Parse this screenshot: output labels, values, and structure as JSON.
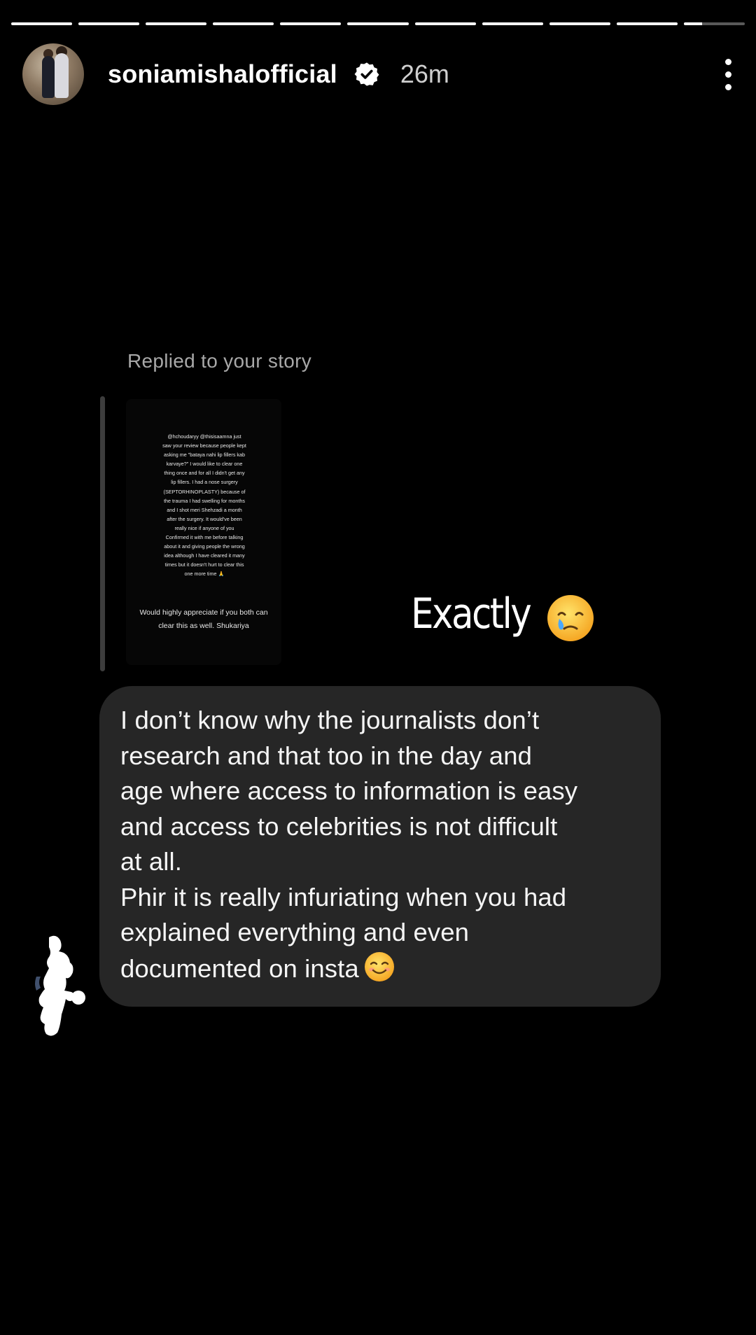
{
  "story": {
    "segments_total": 11,
    "current_segment_progress": 0.3
  },
  "header": {
    "username": "soniamishalofficial",
    "time": "26m",
    "verified_icon": "verified-badge-icon",
    "more_icon": "more-vertical-icon"
  },
  "reply": {
    "label": "Replied to your story",
    "story_text": "@hchoudaryy @thisisaamna just saw your review because people kept asking me \"bataya nahi lip fillers kab karvaye?\" I would like to clear one thing once and for all I didn't get any lip fillers. I had a nose surgery (SEPTORHINOPLASTY) because of the trauma I had swelling for months and I shot meri Shehzadi a month after the surgery. It would've been really nice if anyone of you Confirmed it with me before talking about it and giving people the wrong idea although I have cleared it many times but it doesn't hurt to clear this one more time 🙏",
    "story_text_2": "Would highly appreciate if you both can clear this as well. Shukariya",
    "overlay_text": "Exactly",
    "overlay_emoji": "face-holding-back-tears-icon"
  },
  "message": {
    "text": "I don’t know why the journalists don’t\nresearch and that too in the day and\nage where access to information is easy\nand access to celebrities is not difficult\nat all.\nPhir it is really infuriating when you had\nexplained everything and even\ndocumented on insta",
    "emoji": "smiling-face-icon"
  }
}
